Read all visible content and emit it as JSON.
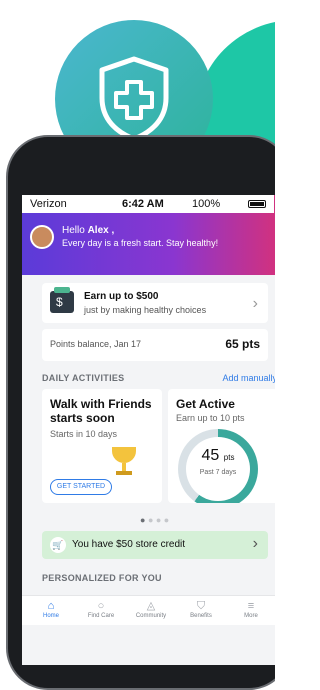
{
  "status_bar": {
    "carrier": "Verizon",
    "time": "6:42 AM",
    "battery": "100%"
  },
  "greeting": {
    "hello_prefix": "Hello",
    "name": "Alex ,",
    "message": "Every day is a fresh start. Stay healthy!"
  },
  "earn_card": {
    "title": "Earn up to $500",
    "subtitle": "just by making healthy choices"
  },
  "points": {
    "label": "Points balance, Jan 17",
    "value": "65 pts"
  },
  "daily": {
    "title": "DAILY ACTIVITIES",
    "add_label": "Add manually",
    "walk": {
      "title_line1": "Walk with Friends",
      "title_line2": "starts soon",
      "desc": "Starts in 10 days",
      "button": "GET STARTED"
    },
    "active": {
      "title": "Get Active",
      "desc": "Earn up to 10 pts",
      "value": "45",
      "unit": "pts",
      "period": "Past 7 days"
    }
  },
  "carousel": {
    "active_index": 0,
    "count": 4
  },
  "credit": {
    "text": "You have $50 store credit"
  },
  "personalized_title": "PERSONALIZED FOR YOU",
  "tabs": [
    {
      "label": "Home",
      "icon": "home-icon"
    },
    {
      "label": "Find Care",
      "icon": "search-icon"
    },
    {
      "label": "Community",
      "icon": "people-icon"
    },
    {
      "label": "Benefits",
      "icon": "shield-icon"
    },
    {
      "label": "More",
      "icon": "menu-icon"
    }
  ],
  "colors": {
    "accent": "#2f7be6",
    "teal": "#1ec7a6",
    "credit_bg": "#d5f0d7"
  }
}
